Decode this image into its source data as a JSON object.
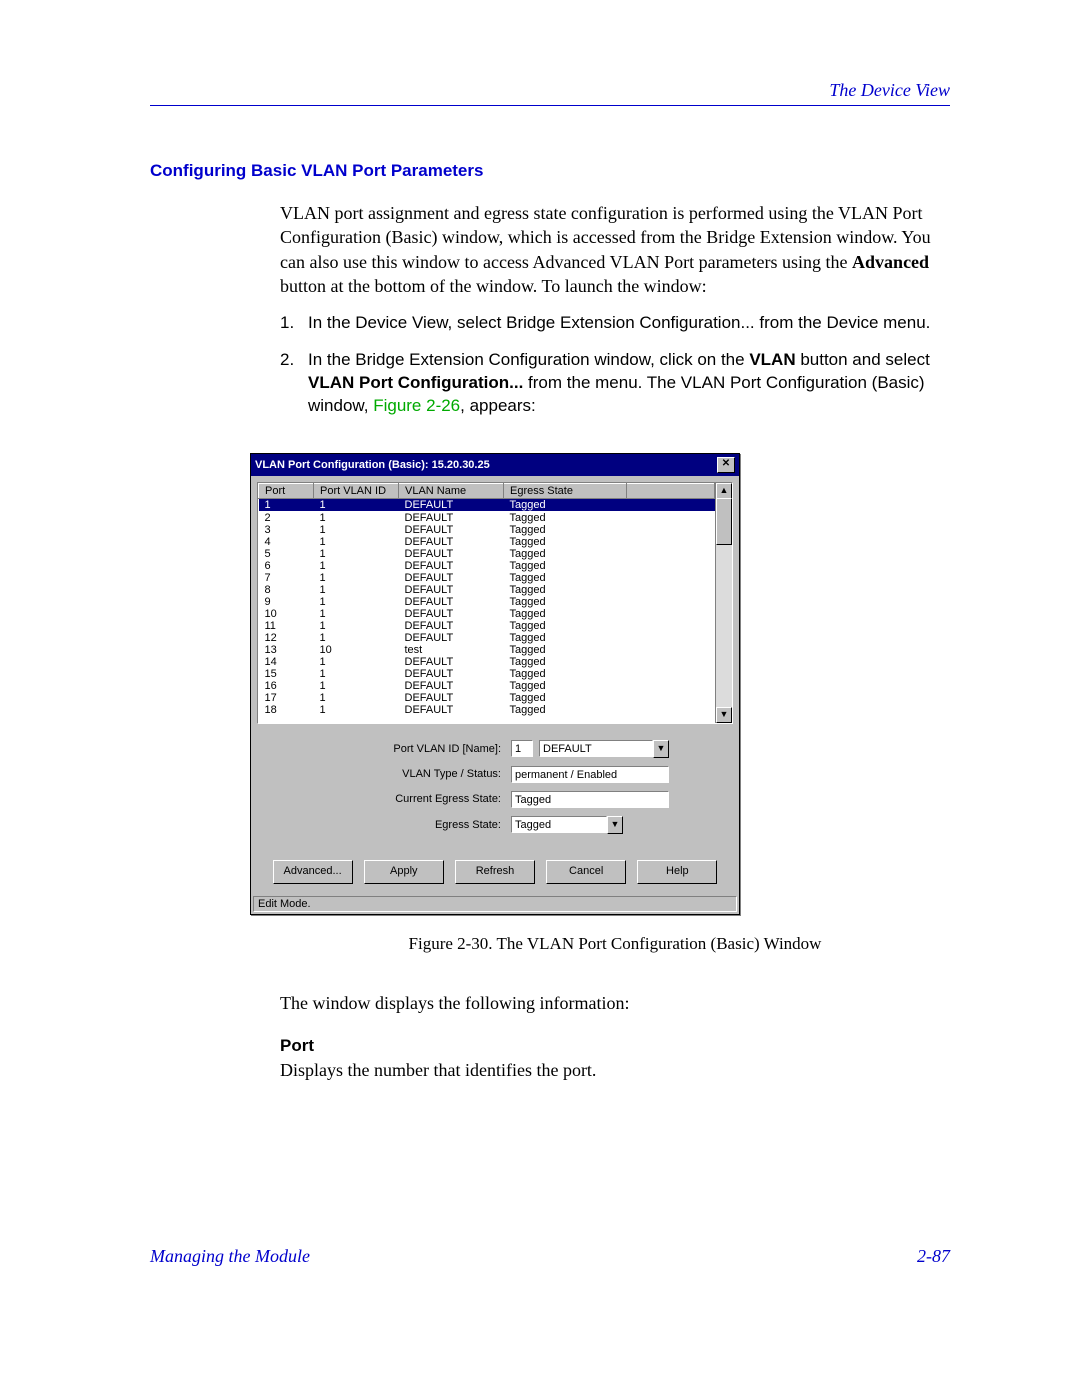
{
  "header": {
    "section_title": "The Device View"
  },
  "section_heading": "Configuring Basic VLAN Port Parameters",
  "intro_paragraph": "VLAN port assignment and egress state configuration is performed using the VLAN Port Configuration (Basic) window, which is accessed from the Bridge Extension window. You can also use this window to access Advanced VLAN Port parameters using the ",
  "intro_bold": "Advanced",
  "intro_tail": " button at the bottom of the window. To launch the window:",
  "steps": [
    {
      "num": "1.",
      "text": "In the Device View, select Bridge Extension Configuration... from the Device menu."
    },
    {
      "num": "2.",
      "pre": "In the Bridge Extension Configuration window, click on the ",
      "b1": "VLAN",
      "mid": " button and select ",
      "b2": "VLAN Port Configuration...",
      "post": " from the menu. The VLAN Port Configuration (Basic) window, ",
      "figref": "Figure 2-26",
      "tail": ", appears:"
    }
  ],
  "dialog": {
    "title": "VLAN Port Configuration (Basic): 15.20.30.25",
    "headers": {
      "port": "Port",
      "vid": "Port VLAN ID",
      "name": "VLAN Name",
      "egress": "Egress State"
    },
    "rows": [
      {
        "port": "1",
        "vid": "1",
        "name": "DEFAULT",
        "egress": "Tagged",
        "selected": true
      },
      {
        "port": "2",
        "vid": "1",
        "name": "DEFAULT",
        "egress": "Tagged"
      },
      {
        "port": "3",
        "vid": "1",
        "name": "DEFAULT",
        "egress": "Tagged"
      },
      {
        "port": "4",
        "vid": "1",
        "name": "DEFAULT",
        "egress": "Tagged"
      },
      {
        "port": "5",
        "vid": "1",
        "name": "DEFAULT",
        "egress": "Tagged"
      },
      {
        "port": "6",
        "vid": "1",
        "name": "DEFAULT",
        "egress": "Tagged"
      },
      {
        "port": "7",
        "vid": "1",
        "name": "DEFAULT",
        "egress": "Tagged"
      },
      {
        "port": "8",
        "vid": "1",
        "name": "DEFAULT",
        "egress": "Tagged"
      },
      {
        "port": "9",
        "vid": "1",
        "name": "DEFAULT",
        "egress": "Tagged"
      },
      {
        "port": "10",
        "vid": "1",
        "name": "DEFAULT",
        "egress": "Tagged"
      },
      {
        "port": "11",
        "vid": "1",
        "name": "DEFAULT",
        "egress": "Tagged"
      },
      {
        "port": "12",
        "vid": "1",
        "name": "DEFAULT",
        "egress": "Tagged"
      },
      {
        "port": "13",
        "vid": "10",
        "name": "test",
        "egress": "Tagged"
      },
      {
        "port": "14",
        "vid": "1",
        "name": "DEFAULT",
        "egress": "Tagged"
      },
      {
        "port": "15",
        "vid": "1",
        "name": "DEFAULT",
        "egress": "Tagged"
      },
      {
        "port": "16",
        "vid": "1",
        "name": "DEFAULT",
        "egress": "Tagged"
      },
      {
        "port": "17",
        "vid": "1",
        "name": "DEFAULT",
        "egress": "Tagged"
      },
      {
        "port": "18",
        "vid": "1",
        "name": "DEFAULT",
        "egress": "Tagged",
        "cutoff": true
      }
    ],
    "fields": {
      "port_vlan_id_label": "Port VLAN ID  [Name]:",
      "port_vlan_id_value": "1",
      "port_vlan_name_value": "DEFAULT",
      "vlan_type_label": "VLAN Type / Status:",
      "vlan_type_value": "permanent / Enabled",
      "current_egress_label": "Current Egress State:",
      "current_egress_value": "Tagged",
      "egress_state_label": "Egress State:",
      "egress_state_value": "Tagged"
    },
    "buttons": {
      "advanced": "Advanced...",
      "apply": "Apply",
      "refresh": "Refresh",
      "cancel": "Cancel",
      "help": "Help"
    },
    "status": "Edit Mode."
  },
  "caption": "Figure 2-30.  The VLAN Port Configuration (Basic) Window",
  "after_fig": "The window displays the following information:",
  "port_heading": "Port",
  "port_desc": "Displays the number that identifies the port.",
  "footer": {
    "left": "Managing the Module",
    "right": "2-87"
  }
}
